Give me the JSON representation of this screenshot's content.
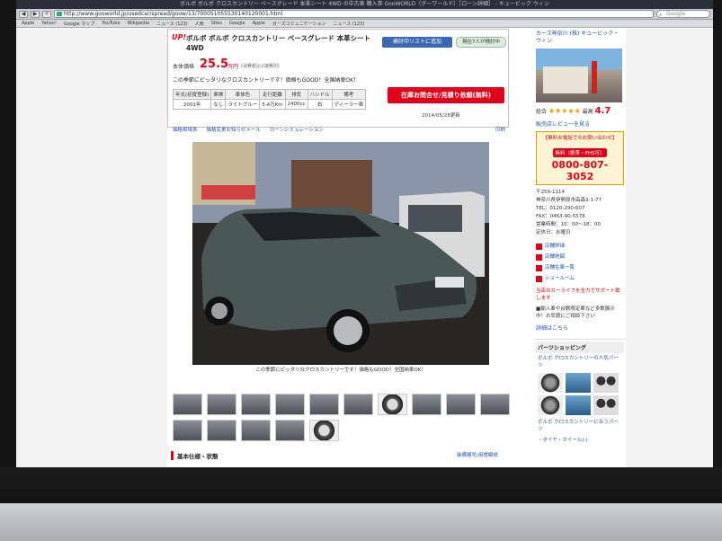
{
  "browser": {
    "window_title": "ボルボ ボルボ クロスカントリー ベースグレード 本革シート 4WD の中古車 購入券 GooWORLD（グーワールド）［ローン詳細］ - キュービック ウィン",
    "url": "http://www.gooworld.jp/usedcar/spread/goow/13/700051055530140120001.html",
    "search_placeholder": "Google",
    "bookmarks": [
      "Apple",
      "Yahoo!",
      "Google マップ",
      "YouTube",
      "Wikipedia",
      "ニュース (123)",
      "人気",
      "Sites",
      "Google",
      "Apple",
      "ガーズコミュニケーション",
      "ニュース (123)"
    ]
  },
  "listing": {
    "up_badge": "UP!",
    "title": "ボルボ ボルボ クロスカントリー ベースグレード 本革シート 4WD",
    "compare_button": "検討中リストに追加",
    "considering": "現在7人が検討中",
    "price_label": "本体価格",
    "price": "25.5",
    "price_unit": "万円",
    "price_note": "(消費税込)(諸費別)",
    "catchphrase": "この季節にピッタリなクロスカントリーです！価格もGOOD！全国納車OK！",
    "spec_headers": [
      "年式(初度登録)",
      "車検",
      "車体色",
      "走行距離",
      "排気",
      "ハンドル",
      "備考"
    ],
    "spec_values": [
      "2001年",
      "なし",
      "ライトブルー",
      "5.4万Km",
      "2400cc",
      "右",
      "ディーラー車"
    ],
    "inquiry_button": "在庫お問合せ/見積り依頼(無料)",
    "updated": "2014/05/28更新",
    "links": [
      "価格相場表",
      "価格変更お知らせメール",
      "ローンシミュレーション"
    ],
    "print": "印刷",
    "photo_caption": "この季節にピッタリなクロスカントリーです！価格もGOOD！全国納車OK！",
    "section_title": "基本仕様・状態",
    "help_link": "装備略号/用語解説"
  },
  "sidebar": {
    "dealer_name": "カーズ神奈川 (株) キュービック・ウィン",
    "rating_label": "総合",
    "rating_stars": "★★★★★",
    "rating_tag": "最高",
    "rating_value": "4.7",
    "review_link": "販売店レビューを見る",
    "call_title": "【無料お電話でのお問い合わせ】",
    "call_badge": "無料（携帯・PHS可）",
    "phone": "0800-807-3052",
    "address_lines": [
      "〒259-1114",
      "神奈川県伊勢原市高森3-1-77",
      "TEL：0120-290-607",
      "FAX：0463-90-5578",
      "営業時間：10：00〜18：00",
      "定休日：水曜日"
    ],
    "shop_links": [
      "店舗詳細",
      "店舗地図",
      "店舗在庫一覧",
      "ショールーム"
    ],
    "notice": "当店のカーライフを全力でサポート致します",
    "notice2": "■輸入車や台数限定車など多数展示中！お気軽にご相談下さい",
    "notice_link": "詳細はこちら",
    "parts_title": "パーツショッピング",
    "parts_link": "ボルボ クロスカントリーの人気パーツ",
    "parts_link2": "ボルボ クロスカントリーに合うパーツ",
    "parts_link3": "・タイヤ・ホイール(-)"
  }
}
